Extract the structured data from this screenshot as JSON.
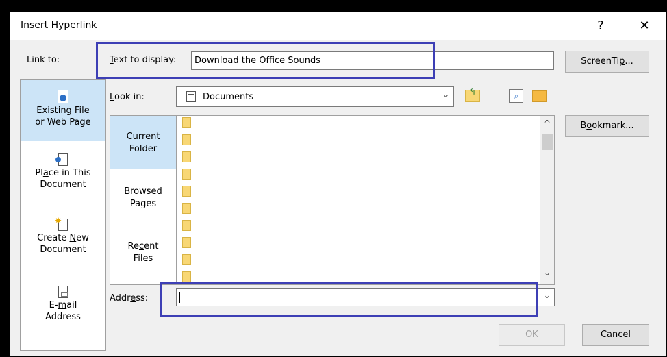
{
  "dialog": {
    "title": "Insert Hyperlink",
    "help_glyph": "?",
    "close_glyph": "✕"
  },
  "link_to": {
    "label": "Link to:",
    "items": [
      {
        "line1": "Existing File",
        "line2": "or Web Page",
        "icon": "web-file-icon",
        "selected": true
      },
      {
        "line1": "Place in This",
        "line2": "Document",
        "icon": "place-in-document-icon",
        "selected": false
      },
      {
        "line1": "Create New",
        "line2": "Document",
        "icon": "new-document-icon",
        "selected": false
      },
      {
        "line1": "E-mail",
        "line2": "Address",
        "icon": "email-icon",
        "selected": false
      }
    ]
  },
  "text_to_display": {
    "label": "Text to display:",
    "value": "Download the Office Sounds"
  },
  "screentip_button": "ScreenTip...",
  "look_in": {
    "label": "Look in:",
    "value": "Documents",
    "icon": "documents-icon",
    "dropdown_glyph": "⌄"
  },
  "toolbar_icons": [
    "up-folder-icon",
    "browse-web-icon",
    "browse-folder-icon"
  ],
  "subnav": [
    {
      "line1": "Current",
      "line2": "Folder",
      "selected": true
    },
    {
      "line1": "Browsed",
      "line2": "Pages",
      "selected": false
    },
    {
      "line1": "Recent",
      "line2": "Files",
      "selected": false
    }
  ],
  "bookmark_button": "Bookmark...",
  "scroll_up_glyph": "^",
  "scroll_down_glyph": "⌄",
  "address": {
    "label": "Address:",
    "value": "",
    "dropdown_glyph": "⌄"
  },
  "ok_button": "OK",
  "cancel_button": "Cancel",
  "colors": {
    "highlight_border": "#3d3fb5",
    "selected_bg": "#cce4f7",
    "folder_fill": "#f8d775"
  }
}
